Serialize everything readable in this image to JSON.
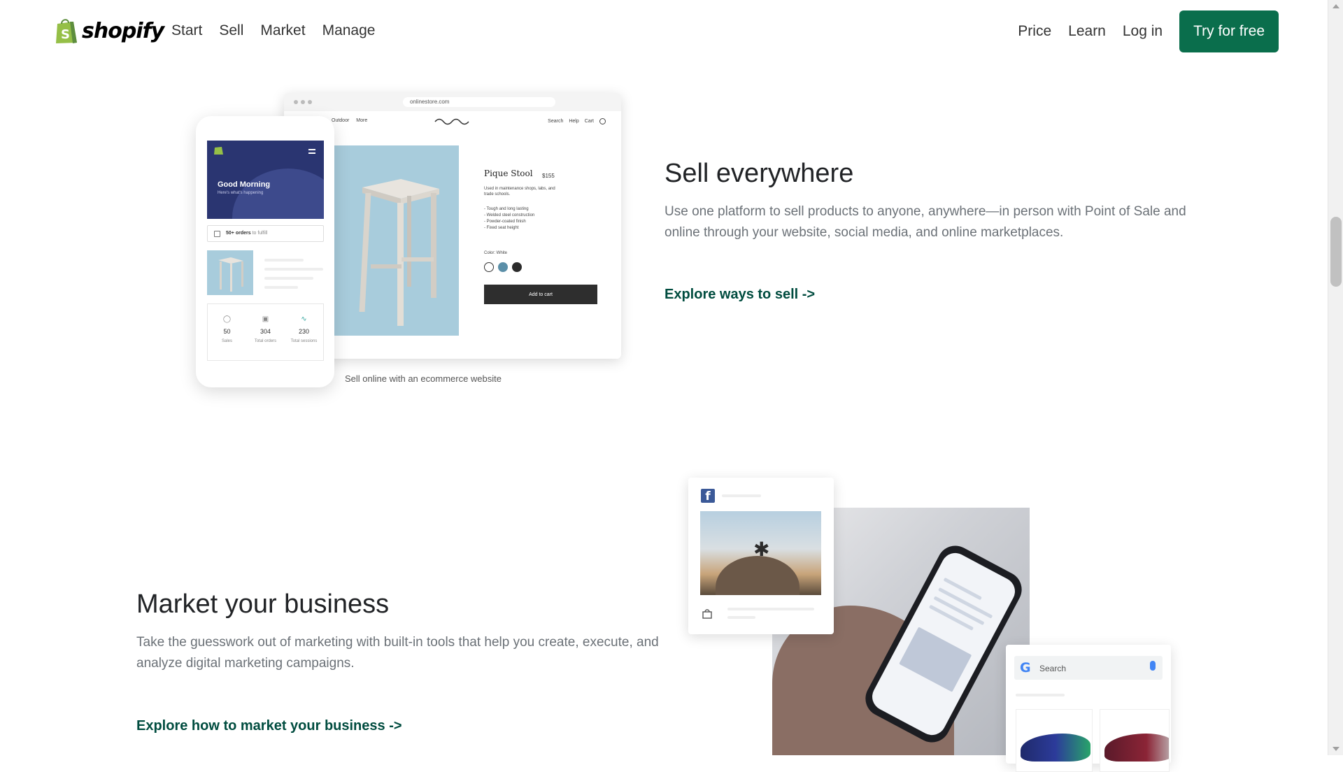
{
  "header": {
    "brand": "shopify",
    "nav_left": [
      "Start",
      "Sell",
      "Market",
      "Manage"
    ],
    "nav_right": [
      "Price",
      "Learn",
      "Log in"
    ],
    "cta": "Try for free"
  },
  "sell_section": {
    "title": "Sell everywhere",
    "description": "Use one platform to sell products to anyone, anywhere—in person with Point of Sale and online through your website, social media, and online marketplaces.",
    "link": "Explore ways to sell ->",
    "caption": "Sell online with an ecommerce website",
    "browser": {
      "url": "onlinestore.com",
      "nav_left": [
        "Outdoor",
        "More"
      ],
      "nav_right": [
        "Search",
        "Help",
        "Cart"
      ],
      "product_title": "Pique Stool",
      "product_price": "$155",
      "product_description": "Used in maintenance shops, labs, and trade schools.",
      "product_features": [
        "- Tough and long lasting",
        "- Welded steel construction",
        "- Powder-coated finish",
        "- Fixed seat height"
      ],
      "color_label": "Color: White",
      "swatch_colors": [
        "#ffffff",
        "#5b8fa8",
        "#2b2b2b"
      ],
      "add_to_cart": "Add to cart"
    },
    "phone": {
      "greeting": "Good Morning",
      "greeting_sub": "Here's what's happening",
      "orders_strong": "50+ orders",
      "orders_muted": "to fulfill",
      "stats": [
        {
          "icon": "dollar-icon",
          "value": "50",
          "label": "Sales"
        },
        {
          "icon": "box-icon",
          "value": "304",
          "label": "Total orders"
        },
        {
          "icon": "trend-icon",
          "value": "230",
          "label": "Total sessions"
        }
      ]
    }
  },
  "market_section": {
    "title": "Market your business",
    "description": "Take the guesswork out of marketing with built-in tools that help you create, execute, and analyze digital marketing campaigns.",
    "link": "Explore how to market your business ->",
    "search_placeholder": "Search"
  },
  "colors": {
    "brand_green": "#0a6e4c",
    "link_green": "#004c3f",
    "text_muted": "#6b7177"
  }
}
